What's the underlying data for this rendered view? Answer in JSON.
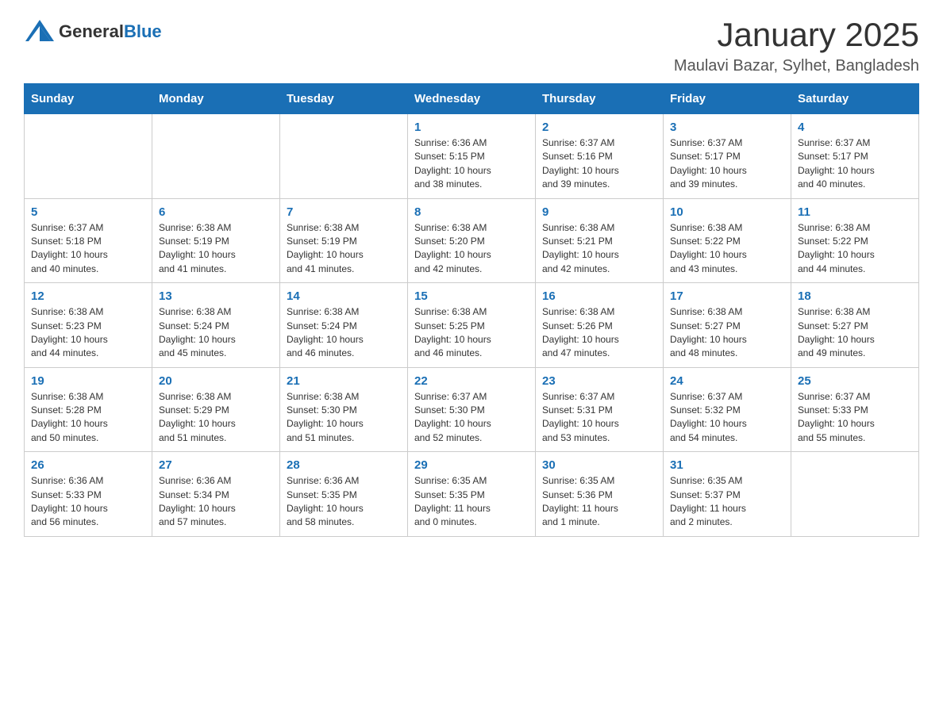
{
  "header": {
    "logo_general": "General",
    "logo_blue": "Blue",
    "month_title": "January 2025",
    "location": "Maulavi Bazar, Sylhet, Bangladesh"
  },
  "days_of_week": [
    "Sunday",
    "Monday",
    "Tuesday",
    "Wednesday",
    "Thursday",
    "Friday",
    "Saturday"
  ],
  "weeks": [
    [
      {
        "day": "",
        "info": ""
      },
      {
        "day": "",
        "info": ""
      },
      {
        "day": "",
        "info": ""
      },
      {
        "day": "1",
        "info": "Sunrise: 6:36 AM\nSunset: 5:15 PM\nDaylight: 10 hours\nand 38 minutes."
      },
      {
        "day": "2",
        "info": "Sunrise: 6:37 AM\nSunset: 5:16 PM\nDaylight: 10 hours\nand 39 minutes."
      },
      {
        "day": "3",
        "info": "Sunrise: 6:37 AM\nSunset: 5:17 PM\nDaylight: 10 hours\nand 39 minutes."
      },
      {
        "day": "4",
        "info": "Sunrise: 6:37 AM\nSunset: 5:17 PM\nDaylight: 10 hours\nand 40 minutes."
      }
    ],
    [
      {
        "day": "5",
        "info": "Sunrise: 6:37 AM\nSunset: 5:18 PM\nDaylight: 10 hours\nand 40 minutes."
      },
      {
        "day": "6",
        "info": "Sunrise: 6:38 AM\nSunset: 5:19 PM\nDaylight: 10 hours\nand 41 minutes."
      },
      {
        "day": "7",
        "info": "Sunrise: 6:38 AM\nSunset: 5:19 PM\nDaylight: 10 hours\nand 41 minutes."
      },
      {
        "day": "8",
        "info": "Sunrise: 6:38 AM\nSunset: 5:20 PM\nDaylight: 10 hours\nand 42 minutes."
      },
      {
        "day": "9",
        "info": "Sunrise: 6:38 AM\nSunset: 5:21 PM\nDaylight: 10 hours\nand 42 minutes."
      },
      {
        "day": "10",
        "info": "Sunrise: 6:38 AM\nSunset: 5:22 PM\nDaylight: 10 hours\nand 43 minutes."
      },
      {
        "day": "11",
        "info": "Sunrise: 6:38 AM\nSunset: 5:22 PM\nDaylight: 10 hours\nand 44 minutes."
      }
    ],
    [
      {
        "day": "12",
        "info": "Sunrise: 6:38 AM\nSunset: 5:23 PM\nDaylight: 10 hours\nand 44 minutes."
      },
      {
        "day": "13",
        "info": "Sunrise: 6:38 AM\nSunset: 5:24 PM\nDaylight: 10 hours\nand 45 minutes."
      },
      {
        "day": "14",
        "info": "Sunrise: 6:38 AM\nSunset: 5:24 PM\nDaylight: 10 hours\nand 46 minutes."
      },
      {
        "day": "15",
        "info": "Sunrise: 6:38 AM\nSunset: 5:25 PM\nDaylight: 10 hours\nand 46 minutes."
      },
      {
        "day": "16",
        "info": "Sunrise: 6:38 AM\nSunset: 5:26 PM\nDaylight: 10 hours\nand 47 minutes."
      },
      {
        "day": "17",
        "info": "Sunrise: 6:38 AM\nSunset: 5:27 PM\nDaylight: 10 hours\nand 48 minutes."
      },
      {
        "day": "18",
        "info": "Sunrise: 6:38 AM\nSunset: 5:27 PM\nDaylight: 10 hours\nand 49 minutes."
      }
    ],
    [
      {
        "day": "19",
        "info": "Sunrise: 6:38 AM\nSunset: 5:28 PM\nDaylight: 10 hours\nand 50 minutes."
      },
      {
        "day": "20",
        "info": "Sunrise: 6:38 AM\nSunset: 5:29 PM\nDaylight: 10 hours\nand 51 minutes."
      },
      {
        "day": "21",
        "info": "Sunrise: 6:38 AM\nSunset: 5:30 PM\nDaylight: 10 hours\nand 51 minutes."
      },
      {
        "day": "22",
        "info": "Sunrise: 6:37 AM\nSunset: 5:30 PM\nDaylight: 10 hours\nand 52 minutes."
      },
      {
        "day": "23",
        "info": "Sunrise: 6:37 AM\nSunset: 5:31 PM\nDaylight: 10 hours\nand 53 minutes."
      },
      {
        "day": "24",
        "info": "Sunrise: 6:37 AM\nSunset: 5:32 PM\nDaylight: 10 hours\nand 54 minutes."
      },
      {
        "day": "25",
        "info": "Sunrise: 6:37 AM\nSunset: 5:33 PM\nDaylight: 10 hours\nand 55 minutes."
      }
    ],
    [
      {
        "day": "26",
        "info": "Sunrise: 6:36 AM\nSunset: 5:33 PM\nDaylight: 10 hours\nand 56 minutes."
      },
      {
        "day": "27",
        "info": "Sunrise: 6:36 AM\nSunset: 5:34 PM\nDaylight: 10 hours\nand 57 minutes."
      },
      {
        "day": "28",
        "info": "Sunrise: 6:36 AM\nSunset: 5:35 PM\nDaylight: 10 hours\nand 58 minutes."
      },
      {
        "day": "29",
        "info": "Sunrise: 6:35 AM\nSunset: 5:35 PM\nDaylight: 11 hours\nand 0 minutes."
      },
      {
        "day": "30",
        "info": "Sunrise: 6:35 AM\nSunset: 5:36 PM\nDaylight: 11 hours\nand 1 minute."
      },
      {
        "day": "31",
        "info": "Sunrise: 6:35 AM\nSunset: 5:37 PM\nDaylight: 11 hours\nand 2 minutes."
      },
      {
        "day": "",
        "info": ""
      }
    ]
  ]
}
